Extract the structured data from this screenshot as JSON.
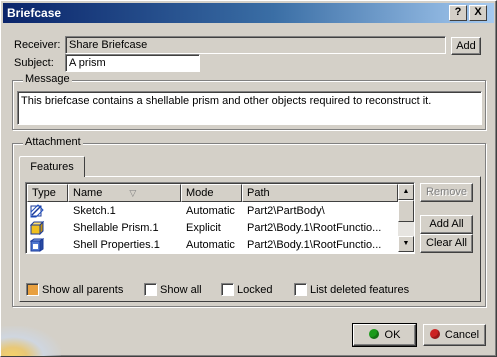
{
  "window": {
    "title": "Briefcase",
    "help_glyph": "?",
    "close_glyph": "X"
  },
  "receiver": {
    "label": "Receiver:",
    "value": "Share Briefcase",
    "add_label": "Add"
  },
  "subject": {
    "label": "Subject:",
    "value": "A prism"
  },
  "message": {
    "group_label": "Message",
    "text": "This briefcase contains a shellable prism and other objects required to reconstruct it."
  },
  "attachment": {
    "group_label": "Attachment",
    "tab_label": "Features",
    "columns": {
      "type": "Type",
      "name": "Name",
      "mode": "Mode",
      "path": "Path"
    },
    "sort_glyph": "▽",
    "rows": [
      {
        "icon": "sketch-icon",
        "name": "Sketch.1",
        "mode": "Automatic",
        "path": "Part2\\PartBody\\"
      },
      {
        "icon": "shellable-prism-icon",
        "name": "Shellable Prism.1",
        "mode": "Explicit",
        "path": "Part2\\Body.1\\RootFunctio..."
      },
      {
        "icon": "shell-properties-icon",
        "name": "Shell Properties.1",
        "mode": "Automatic",
        "path": "Part2\\Body.1\\RootFunctio..."
      }
    ],
    "buttons": {
      "remove": "Remove",
      "add_all": "Add All",
      "clear_all": "Clear All"
    },
    "options": [
      {
        "label": "Show all parents",
        "checked": true
      },
      {
        "label": "Show all",
        "checked": false
      },
      {
        "label": "Locked",
        "checked": false
      },
      {
        "label": "List deleted features",
        "checked": false
      }
    ]
  },
  "footer": {
    "ok_label": "OK",
    "cancel_label": "Cancel"
  },
  "colors": {
    "ok_icon": "#1a9a1a",
    "cancel_icon": "#cc2222",
    "selection": "#0a246a"
  }
}
